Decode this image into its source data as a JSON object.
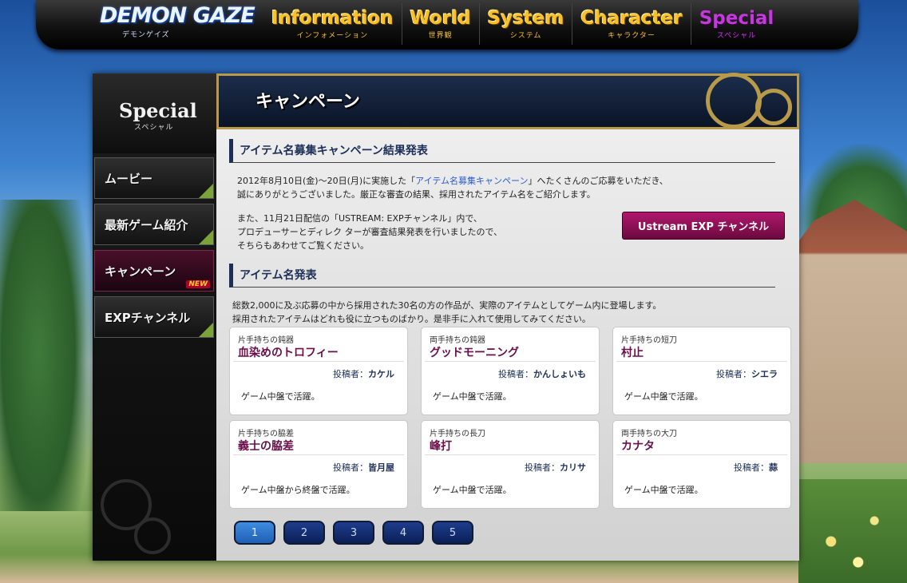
{
  "header": {
    "logo": {
      "text": "DEMON GAZE",
      "sub": "デモンゲイズ"
    },
    "nav": [
      {
        "en": "Information",
        "jp": "インフォメーション"
      },
      {
        "en": "World",
        "jp": "世界観"
      },
      {
        "en": "System",
        "jp": "システム"
      },
      {
        "en": "Character",
        "jp": "キャラクター"
      },
      {
        "en": "Special",
        "jp": "スペシャル"
      }
    ]
  },
  "sidebar": {
    "title_en": "Special",
    "title_jp": "スペシャル",
    "items": [
      {
        "label": "ムービー"
      },
      {
        "label": "最新ゲーム紹介"
      },
      {
        "label": "キャンペーン",
        "badge": "NEW"
      },
      {
        "label": "EXPチャンネル"
      }
    ]
  },
  "content": {
    "page_title": "キャンペーン",
    "section1": {
      "title": "アイテム名募集キャンペーン結果発表",
      "para1_pre": "2012年8月10日(金)〜20日(月)に実施した「",
      "para1_link": "アイテム名募集キャンペーン",
      "para1_post": "」へたくさんのご応募をいただき、",
      "para1_line2": "誠にありがとうございました。厳正な審査の結果、採用されたアイテム名をご紹介します。",
      "para2_line1": "また、11月21日配信の「USTREAM: EXPチャンネル」内で、",
      "para2_line2": "プロデューサーとディレク ターが審査結果発表を行いましたので、",
      "para2_line3": "そちらもあわせてご覧ください。",
      "ustream_button": "Ustream EXP チャンネル"
    },
    "section2": {
      "title": "アイテム名発表",
      "line1": "総数2,000に及ぶ応募の中から採用された30名の方の作品が、実際のアイテムとしてゲーム内に登場します。",
      "line2": "採用されたアイテムはどれも役に立つものばかり。是非手に入れて使用してみてください。"
    },
    "author_label": "投稿者：",
    "cards": [
      {
        "type": "片手持ちの鈍器",
        "name": "血染めのトロフィー",
        "author": "カケル",
        "desc": "ゲーム中盤で活躍。"
      },
      {
        "type": "両手持ちの鈍器",
        "name": "グッドモーニング",
        "author": "かんしょいも",
        "desc": "ゲーム中盤で活躍。"
      },
      {
        "type": "片手持ちの短刀",
        "name": "村止",
        "author": "シエラ",
        "desc": "ゲーム中盤で活躍。"
      },
      {
        "type": "片手持ちの脇差",
        "name": "義士の脇差",
        "author": "皆月屋",
        "desc": "ゲーム中盤から終盤で活躍。"
      },
      {
        "type": "片手持ちの長刀",
        "name": "峰打",
        "author": "カリサ",
        "desc": "ゲーム中盤で活躍。"
      },
      {
        "type": "両手持ちの大刀",
        "name": "カナタ",
        "author": "蒜",
        "desc": "ゲーム中盤で活躍。"
      }
    ],
    "pagination": [
      "1",
      "2",
      "3",
      "4",
      "5"
    ],
    "current_page": "1"
  }
}
